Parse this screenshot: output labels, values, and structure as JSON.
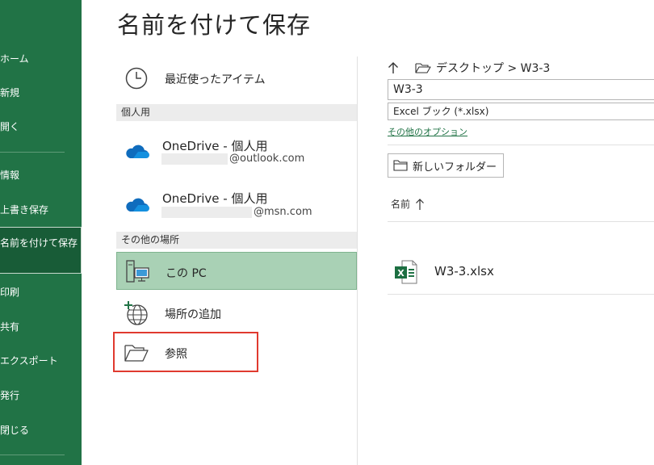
{
  "nav": {
    "items": [
      {
        "id": "home",
        "label": "ホーム"
      },
      {
        "id": "new",
        "label": "新規"
      },
      {
        "id": "open",
        "label": "開く"
      },
      {
        "id": "info",
        "label": "情報"
      },
      {
        "id": "save",
        "label": "上書き保存"
      },
      {
        "id": "saveas",
        "label": "名前を付けて保存",
        "active": true
      },
      {
        "id": "print",
        "label": "印刷"
      },
      {
        "id": "share",
        "label": "共有"
      },
      {
        "id": "export",
        "label": "エクスポート"
      },
      {
        "id": "publish",
        "label": "発行"
      },
      {
        "id": "close",
        "label": "閉じる"
      }
    ]
  },
  "page": {
    "title": "名前を付けて保存"
  },
  "locations": {
    "recent": {
      "label": "最近使ったアイテム",
      "icon": "clock-icon"
    },
    "personal_header": "個人用",
    "onedrive1": {
      "label": "OneDrive - 個人用",
      "account_suffix": "@outlook.com",
      "icon": "onedrive-cloud-icon"
    },
    "onedrive2": {
      "label": "OneDrive - 個人用",
      "account_suffix": "@msn.com",
      "icon": "onedrive-cloud-icon"
    },
    "other_header": "その他の場所",
    "this_pc": {
      "label": "この PC",
      "icon": "computer-icon",
      "selected": true
    },
    "add_place": {
      "label": "場所の追加",
      "icon": "globe-add-icon"
    },
    "browse": {
      "label": "参照",
      "icon": "folder-open-icon"
    }
  },
  "save_panel": {
    "breadcrumb": {
      "up_icon": "arrow-up-icon",
      "folder_icon": "folder-open-icon",
      "path": "デスクトップ > W3-3"
    },
    "filename": "W3-3",
    "filetype": "Excel ブック (*.xlsx)",
    "more_options": "その他のオプション",
    "new_folder": "新しいフォルダー",
    "sort_label": "名前",
    "files": [
      {
        "name": "W3-3.xlsx",
        "icon": "excel-file-icon"
      }
    ]
  },
  "colors": {
    "excel_green": "#217346",
    "selected_bg": "#a9d1b5",
    "highlight_red": "#e03a2f",
    "onedrive_blue": "#0f6cbd"
  }
}
